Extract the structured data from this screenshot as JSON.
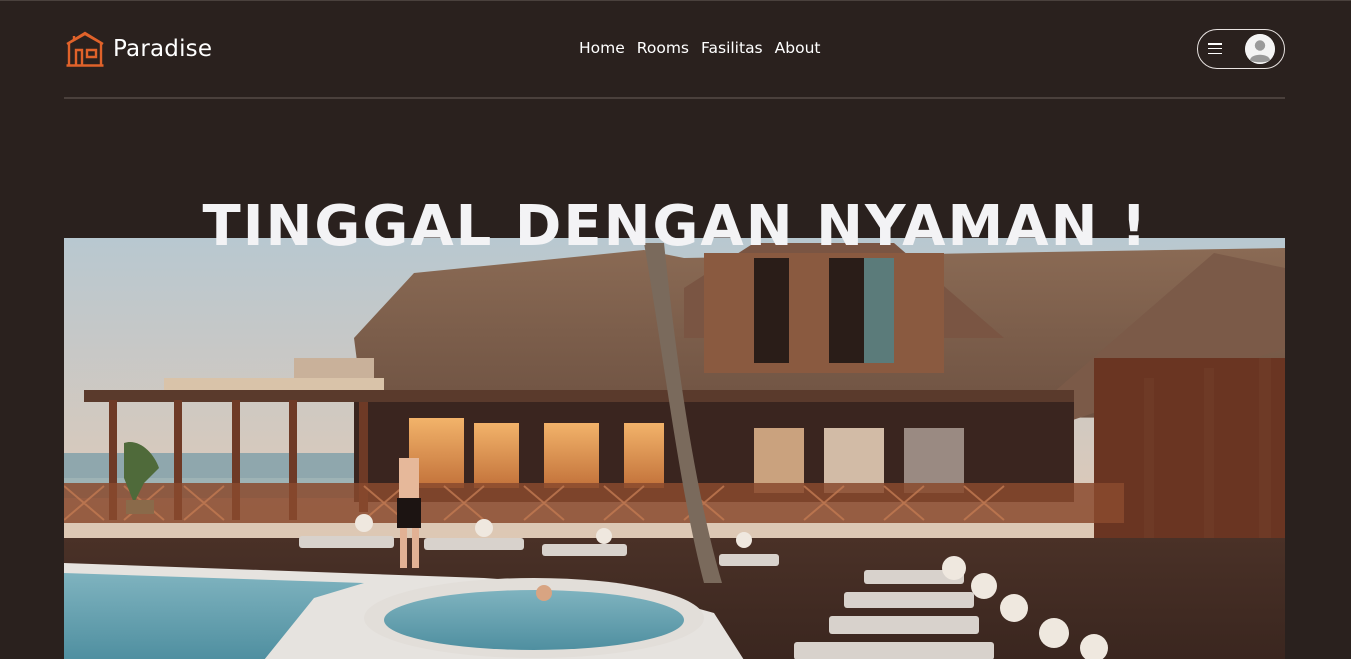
{
  "brand": {
    "name": "Paradise",
    "icon": "house-icon",
    "accent_color": "#e0622a"
  },
  "nav": {
    "links": [
      "Home",
      "Rooms",
      "Fasilitas",
      "About"
    ]
  },
  "user_menu": {
    "menu_icon": "hamburger-icon",
    "avatar_icon": "user-avatar-icon"
  },
  "hero": {
    "title": "TINGGAL DENGAN NYAMAN !",
    "image": "resort-pool-photo"
  },
  "colors": {
    "background": "#2a211e",
    "text": "#ffffff"
  }
}
